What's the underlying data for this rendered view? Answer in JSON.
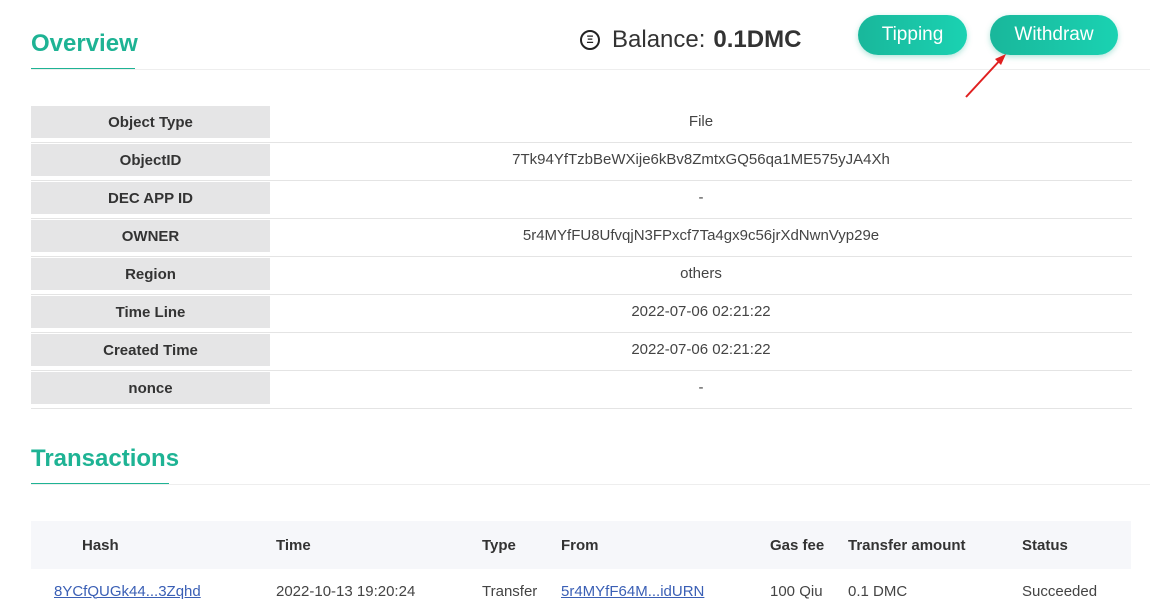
{
  "overview": {
    "title": "Overview",
    "rows": [
      {
        "key": "Object Type",
        "value": "File"
      },
      {
        "key": "ObjectID",
        "value": "7Tk94YfTzbBeWXije6kBv8ZmtxGQ56qa1ME575yJA4Xh"
      },
      {
        "key": "DEC APP ID",
        "value": "-"
      },
      {
        "key": "OWNER",
        "value": "5r4MYfFU8UfvqjN3FPxcf7Ta4gx9c56jrXdNwnVyp29e"
      },
      {
        "key": "Region",
        "value": "others"
      },
      {
        "key": "Time Line",
        "value": "2022-07-06 02:21:22"
      },
      {
        "key": "Created Time",
        "value": "2022-07-06 02:21:22"
      },
      {
        "key": "nonce",
        "value": "-"
      }
    ]
  },
  "balance": {
    "label": "Balance:",
    "amount": "0.1DMC",
    "icon": "dmc-coin-icon"
  },
  "buttons": {
    "tipping": "Tipping",
    "withdraw": "Withdraw"
  },
  "annotation": {
    "arrow_color": "#e02020"
  },
  "transactions": {
    "title": "Transactions",
    "headers": {
      "hash": "Hash",
      "time": "Time",
      "type": "Type",
      "from": "From",
      "gas": "Gas fee",
      "amount": "Transfer amount",
      "status": "Status"
    },
    "rows": [
      {
        "hash": "8YCfQUGk44...3Zqhd",
        "time": "2022-10-13 19:20:24",
        "type": "Transfer",
        "from": "5r4MYfF64M...idURN",
        "gas": "100 Qiu",
        "amount": "0.1 DMC",
        "status": "Succeeded"
      }
    ]
  },
  "colors": {
    "accent": "#1eb394",
    "link": "#3a5fb5"
  }
}
